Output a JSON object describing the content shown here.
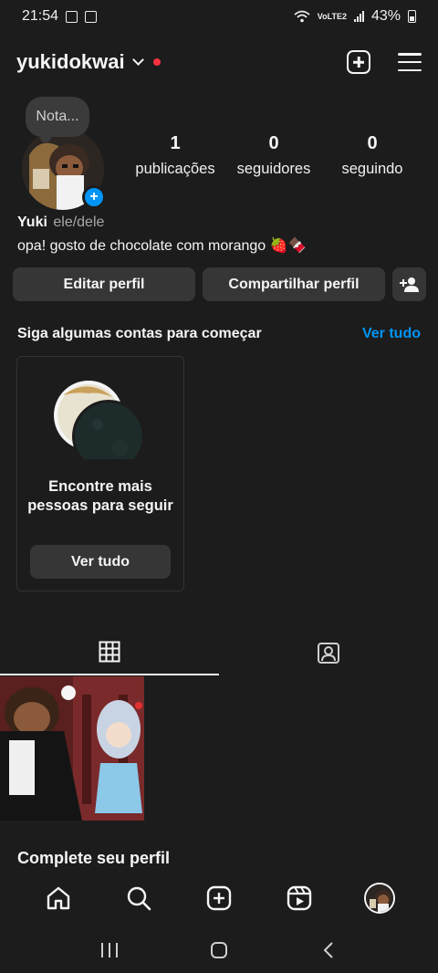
{
  "status_bar": {
    "time": "21:54",
    "network_label": "VoLTE2",
    "battery": "43%"
  },
  "header": {
    "username": "yukidokwai",
    "icons": [
      "chevron-down-icon",
      "notification-dot",
      "new-post-icon",
      "menu-icon"
    ]
  },
  "profile": {
    "note_placeholder": "Nota...",
    "stats": [
      {
        "value": "1",
        "label": "publicações"
      },
      {
        "value": "0",
        "label": "seguidores"
      },
      {
        "value": "0",
        "label": "seguindo"
      }
    ],
    "display_name": "Yuki",
    "pronouns": "ele/dele",
    "bio": "opa! gosto de chocolate com morango 🍓🍫"
  },
  "buttons": {
    "edit": "Editar perfil",
    "share": "Compartilhar perfil"
  },
  "suggestions": {
    "title": "Siga algumas contas para começar",
    "see_all": "Ver tudo",
    "card_text": "Encontre mais pessoas para seguir",
    "card_button": "Ver tudo"
  },
  "tabs": [
    "grid-icon",
    "tagged-icon"
  ],
  "complete_profile": "Complete seu perfil",
  "bottom_nav": [
    "home-icon",
    "search-icon",
    "create-icon",
    "reels-icon",
    "profile-avatar"
  ],
  "colors": {
    "background": "#1c1c1c",
    "button": "#363636",
    "link": "#0095f6",
    "red_dot": "#ff3040"
  }
}
